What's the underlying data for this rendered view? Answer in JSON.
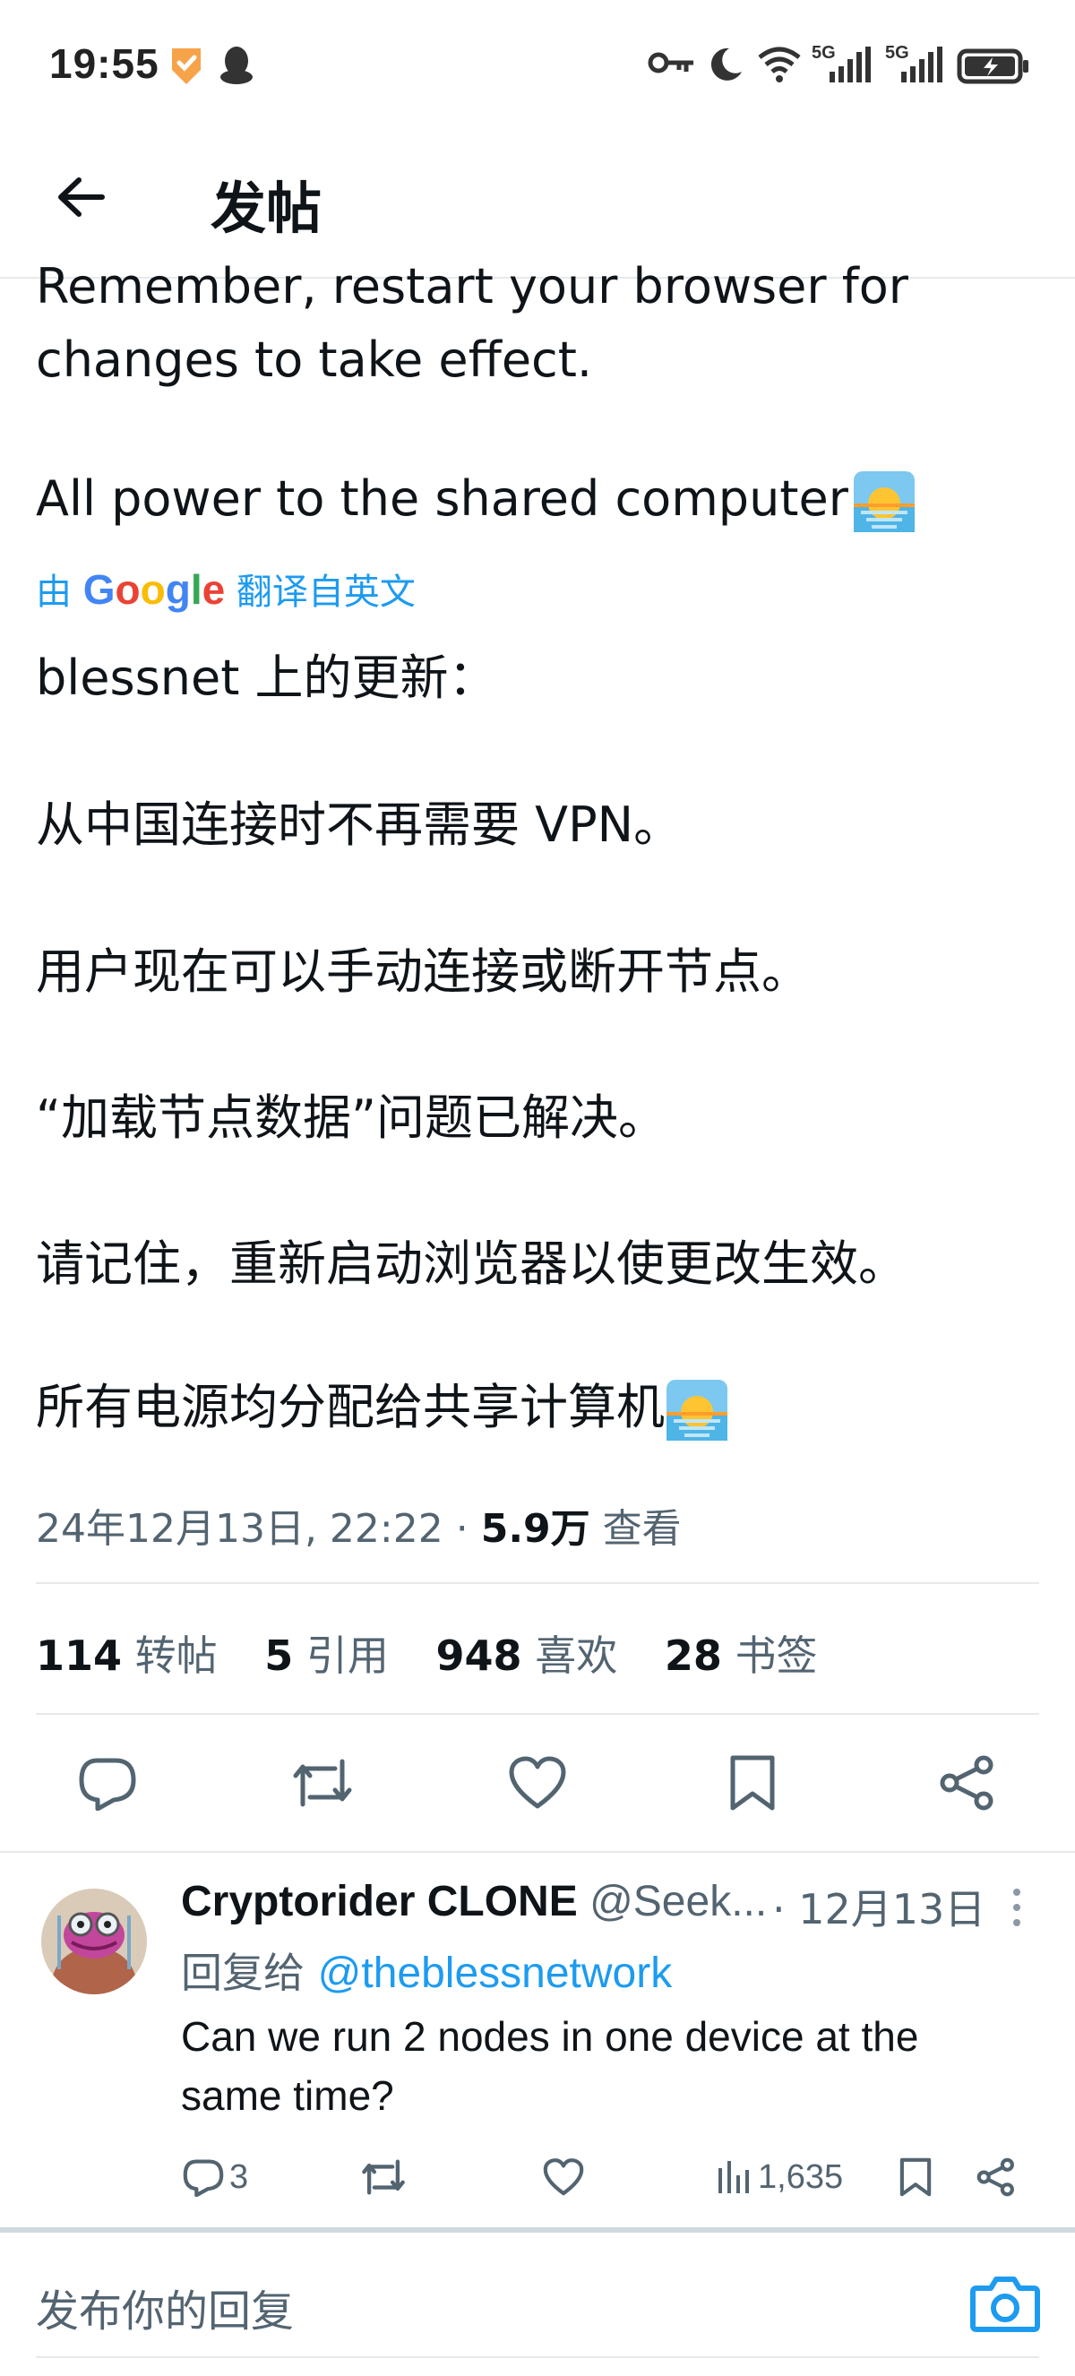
{
  "status_bar": {
    "time": "19:55",
    "signal_label_1": "5G",
    "signal_label_2": "5G"
  },
  "header": {
    "title": "发帖"
  },
  "tweet": {
    "lines_en": [
      "Remember, restart your browser for",
      "changes to take effect.",
      "All power to the shared computer"
    ],
    "translate": {
      "prefix": "由",
      "google": "Google",
      "suffix": "翻译自英文"
    },
    "lines_zh": [
      "blessnet 上的更新：",
      "从中国连接时不再需要 VPN。",
      "用户现在可以手动连接或断开节点。",
      "“加载节点数据”问题已解决。",
      "请记住，重新启动浏览器以使更改生效。",
      "所有电源均分配给共享计算机"
    ],
    "timestamp": "24年12月13日, 22:22 · ",
    "views_count": "5.9万",
    "views_label": " 查看",
    "stats": [
      {
        "num": "114",
        "label": "转帖"
      },
      {
        "num": "5",
        "label": "引用"
      },
      {
        "num": "948",
        "label": "喜欢"
      },
      {
        "num": "28",
        "label": "书签"
      }
    ]
  },
  "reply": {
    "name": "Cryptorider CLONE",
    "handle": "@Seek...",
    "date": "· 12月13日",
    "reply_to_prefix": "回复给 ",
    "reply_to_mention": "@theblessnetwork",
    "text_lines": [
      "Can we run 2 nodes in one device at the",
      "same time?"
    ],
    "reply_count": "3",
    "view_count": "1,635"
  },
  "compose": {
    "placeholder": "发布你的回复"
  },
  "colors": {
    "accent": "#1d9bf0",
    "secondary_text": "#536471",
    "divider": "#e7e9ea"
  }
}
